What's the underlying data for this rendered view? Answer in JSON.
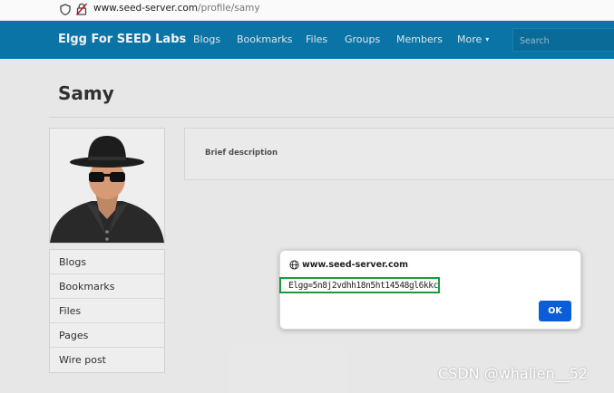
{
  "browser": {
    "url_host": "www.seed-server.com",
    "url_path": "/profile/samy"
  },
  "navbar": {
    "brand": "Elgg For SEED Labs",
    "links": [
      "Blogs",
      "Bookmarks",
      "Files",
      "Groups",
      "Members"
    ],
    "more_label": "More",
    "search_placeholder": "Search",
    "colors": {
      "bar": "#0c7bb0"
    }
  },
  "profile": {
    "name": "Samy",
    "menu": [
      "Blogs",
      "Bookmarks",
      "Files",
      "Pages",
      "Wire post"
    ],
    "description_label": "Brief description"
  },
  "alert": {
    "origin": "www.seed-server.com",
    "message": "Elgg=5n8j2vdhh18n5ht14548gl6kkc",
    "ok_label": "OK",
    "colors": {
      "ok": "#0b5ed8",
      "highlight": "#1f9a3a"
    }
  },
  "watermark": "CSDN @whalien__52"
}
